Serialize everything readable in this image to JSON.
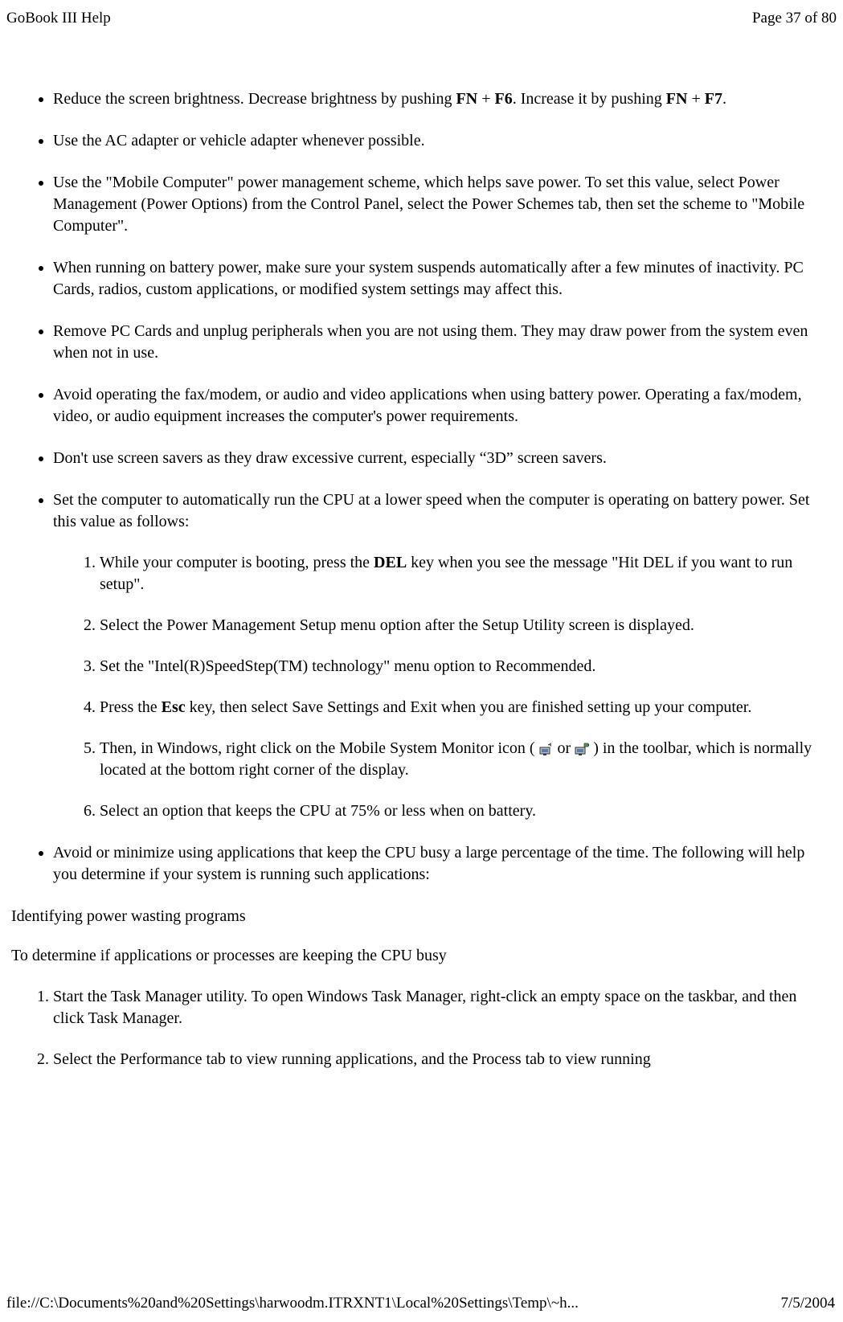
{
  "header": {
    "title": "GoBook III Help",
    "page_indicator": "Page 37 of 80"
  },
  "bullets": [
    {
      "pre": "Reduce the screen brightness. Decrease brightness by pushing ",
      "b1": "FN",
      "mid1": " + ",
      "b2": "F6",
      "mid2": ". Increase it by pushing ",
      "b3": "FN",
      "mid3": " + ",
      "b4": "F7",
      "post": "."
    },
    {
      "text": "Use the AC adapter or vehicle adapter whenever possible."
    },
    {
      "text": "Use the \"Mobile Computer\" power management scheme, which helps save power. To set this value, select Power Management (Power Options) from the Control Panel, select the Power Schemes tab, then set the scheme to \"Mobile Computer\"."
    },
    {
      "text": "When running on battery power, make sure your system suspends automatically after a few minutes of inactivity. PC Cards, radios, custom applications, or modified system settings may affect this."
    },
    {
      "text": "Remove PC Cards and unplug peripherals when you are not using them. They may draw power from the system even when not in use."
    },
    {
      "text": "Avoid operating the fax/modem, or audio and video applications when using battery power. Operating a fax/modem, video, or audio equipment increases the computer's power requirements."
    },
    {
      "text": "Don't use screen savers as they draw excessive current, especially “3D” screen savers."
    },
    {
      "text": "Set the computer to automatically run the CPU at a lower speed when the computer is operating on battery power. Set this value as follows:"
    },
    {
      "text": "Avoid or minimize using applications that keep the CPU busy a large percentage of the time. The following will help you determine if your system is running such applications:"
    }
  ],
  "inner_steps": [
    {
      "pre": "While your computer is booting, press the ",
      "b1": "DEL",
      "post": " key when you see the message \"Hit DEL if you want to run setup\"."
    },
    {
      "text": "Select the Power Management Setup menu option after the Setup Utility screen is displayed."
    },
    {
      "text": "Set the \"Intel(R)SpeedStep(TM) technology\" menu option to Recommended."
    },
    {
      "pre": "Press the ",
      "b1": "Esc",
      "post": " key, then select Save Settings and Exit when you are finished setting up your computer."
    },
    {
      "pre": "Then, in Windows, right click on the Mobile System Monitor icon ( ",
      "mid": " or ",
      "post": " ) in the toolbar, which is normally located at the bottom right corner of the display."
    },
    {
      "text": "Select an option that keeps the CPU at 75% or less when on battery."
    }
  ],
  "section": {
    "heading": "Identifying power wasting programs",
    "intro": "To determine if applications or processes are keeping the CPU busy"
  },
  "outer_steps": [
    {
      "text": "Start the Task Manager utility. To open Windows Task Manager, right-click an empty space on the taskbar, and then click Task Manager."
    },
    {
      "text": "Select the Performance tab to view running applications, and the Process tab to view running"
    }
  ],
  "footer": {
    "path": "file://C:\\Documents%20and%20Settings\\harwoodm.ITRXNT1\\Local%20Settings\\Temp\\~h...",
    "date": "7/5/2004"
  }
}
